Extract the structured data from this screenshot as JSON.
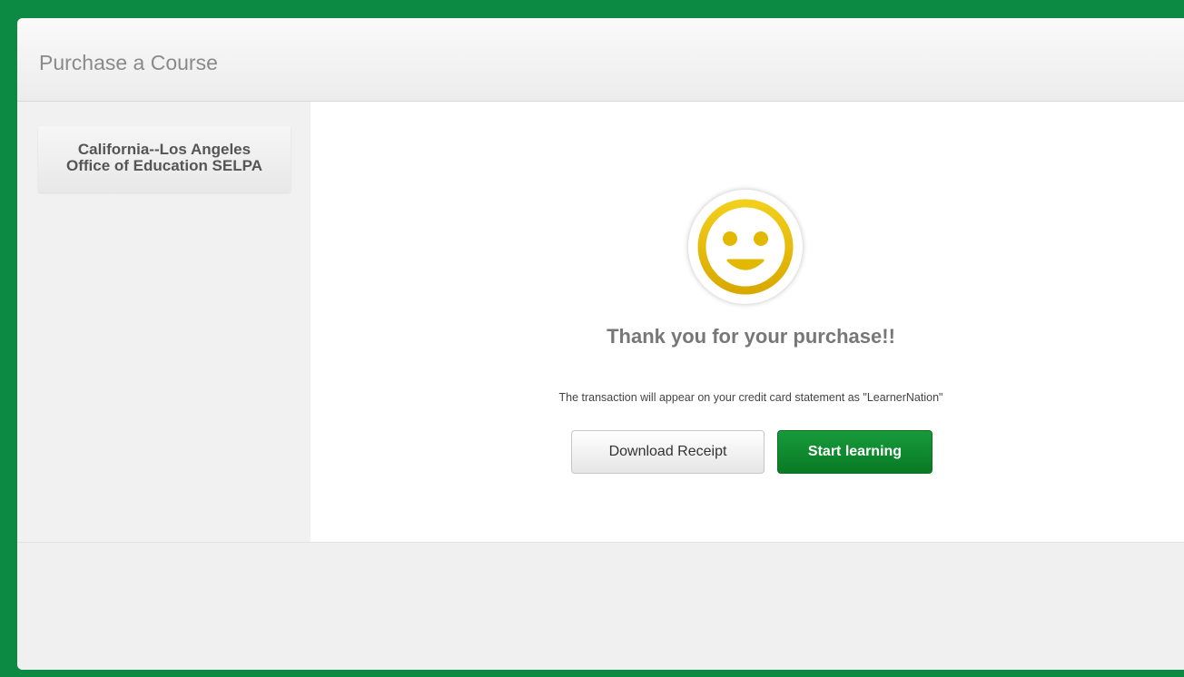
{
  "header": {
    "title": "Purchase a Course"
  },
  "sidebar": {
    "organization_line1": "California--Los Angeles",
    "organization_line2": "Office of Education SELPA"
  },
  "confirmation": {
    "icon": "smiley-face-icon",
    "heading": "Thank you for your purchase!!",
    "statement_note": "The transaction will appear on your credit card statement as \"LearnerNation\""
  },
  "actions": {
    "download_receipt_label": "Download Receipt",
    "start_learning_label": "Start learning"
  },
  "colors": {
    "frame": "#0c8a44",
    "primary_button": "#0f8a30",
    "smiley": "#e2b800"
  }
}
